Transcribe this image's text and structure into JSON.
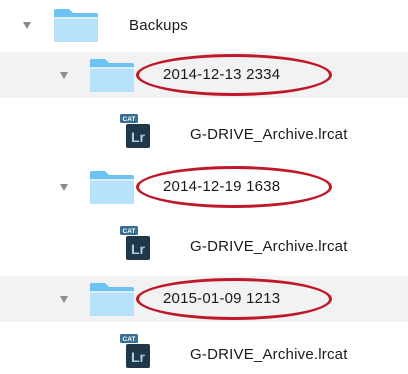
{
  "tree": {
    "root": {
      "name": "Backups",
      "icon": "folder-icon",
      "expanded": true
    },
    "children": [
      {
        "name": "2014-12-13 2334",
        "icon": "folder-icon",
        "expanded": true,
        "highlighted": true,
        "files": [
          {
            "name": "G-DRIVE_Archive.lrcat",
            "icon": "lightroom-catalog-icon",
            "badge": "CAT",
            "glyph": "Lr"
          }
        ]
      },
      {
        "name": "2014-12-19 1638",
        "icon": "folder-icon",
        "expanded": true,
        "highlighted": true,
        "files": [
          {
            "name": "G-DRIVE_Archive.lrcat",
            "icon": "lightroom-catalog-icon",
            "badge": "CAT",
            "glyph": "Lr"
          }
        ]
      },
      {
        "name": "2015-01-09 1213",
        "icon": "folder-icon",
        "expanded": true,
        "highlighted": true,
        "files": [
          {
            "name": "G-DRIVE_Archive.lrcat",
            "icon": "lightroom-catalog-icon",
            "badge": "CAT",
            "glyph": "Lr"
          }
        ]
      }
    ]
  },
  "colors": {
    "folder_light": "#b8e2fb",
    "folder_dark": "#6cc3f2",
    "highlight_oval": "#c0182b",
    "row_alt": "#f2f2f2",
    "lr_bg": "#1f3748",
    "lr_text": "#a7cde7"
  }
}
